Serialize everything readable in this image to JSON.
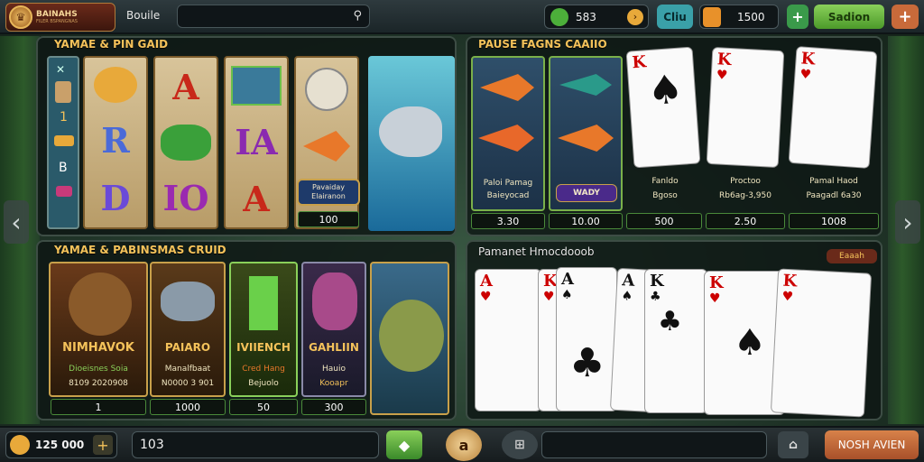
{
  "header": {
    "logo_title": "BAINAHS",
    "logo_sub": "FILER BSPANGNAS",
    "nav_label": "Bouile",
    "balance": "583",
    "deposit_label": "Cliu",
    "coins": "1500",
    "signin_label": "Sadion"
  },
  "slot_panel": {
    "title": "YAMAE & PIN GAID",
    "left_glyphs": [
      "1",
      "B"
    ],
    "reel_symbols": [
      [
        "A",
        "R",
        "D"
      ],
      [
        "A",
        "IA",
        "IO"
      ],
      [
        "",
        "IA",
        "A"
      ]
    ],
    "promo_label": "Pavaiday",
    "promo_sub": "Elairanon",
    "promo_value": "100"
  },
  "fish_panel": {
    "title": "PAUSE FAGNS CAAIIO",
    "items": [
      {
        "caption": "Paloi Pamag",
        "sub": "Baieyocad",
        "value": "3.30"
      },
      {
        "caption": "WADY",
        "sub": "",
        "value": "10.00"
      },
      {
        "caption": "Fanldo",
        "sub": "Bgoso",
        "value": "500"
      },
      {
        "caption": "Proctoo",
        "sub": "Rb6ag-3,950",
        "value": "2.50"
      },
      {
        "caption": "Pamal Haod",
        "sub": "Paagadl 6a30",
        "value": "1008"
      }
    ]
  },
  "game_panel": {
    "title": "YAMAE & PABINSMAS CRUID",
    "items": [
      {
        "name": "NIMHAVOK",
        "l1": "Dioeisnes Soia",
        "l2": "8109 2020908",
        "value": "1"
      },
      {
        "name": "PAIARO",
        "l1": "Manalfbaat",
        "l2": "N0000 3 901",
        "value": "1000"
      },
      {
        "name": "IVIIENCH",
        "l1": "Cred Hang",
        "l2": "Bejuolo",
        "value": "50"
      },
      {
        "name": "GAHLIIN",
        "l1": "Hauio",
        "l2": "Kooapr",
        "value": "300"
      }
    ]
  },
  "cards_panel": {
    "title": "Pamanet Hmocdooob",
    "badge": "Eaaah"
  },
  "footer": {
    "coins": "125 000",
    "bet": "103",
    "spin": "a",
    "action_label": "NOSH AVIEN"
  },
  "colors": {
    "accent": "#f4c25a",
    "green": "#4caf3a",
    "card_red": "#c00000"
  }
}
